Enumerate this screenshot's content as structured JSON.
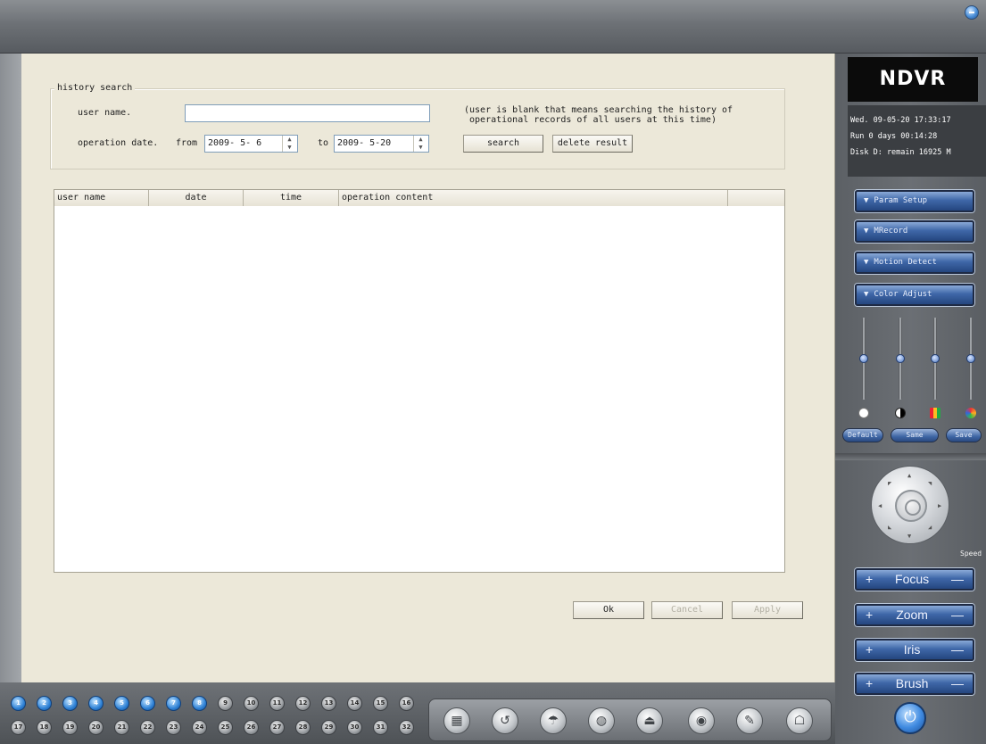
{
  "window": {
    "close_icon": "close-icon"
  },
  "history_search": {
    "legend": "history search",
    "user_name_label": "user name.",
    "user_name_value": "",
    "note_line1": "(user is blank that means searching the history of",
    "note_line2": " operational records of all users at this time)",
    "operation_date_label": "operation date.",
    "from_label": "from",
    "from_value": "2009- 5- 6",
    "to_label": "to",
    "to_value": "2009- 5-20",
    "search_label": "search",
    "delete_label": "delete result"
  },
  "table": {
    "columns": [
      "user name",
      "date",
      "time",
      "operation content",
      ""
    ],
    "rows": []
  },
  "footer_buttons": {
    "ok": "Ok",
    "cancel": "Cancel",
    "apply": "Apply"
  },
  "right_panel": {
    "logo": "NDVR",
    "info_line1": "Wed.  09-05-20 17:33:17",
    "info_line2": "Run 0 days 00:14:28",
    "info_line3": "Disk D: remain 16925 M",
    "menu": [
      {
        "label": "Param Setup"
      },
      {
        "label": "MRecord"
      },
      {
        "label": "Motion Detect"
      },
      {
        "label": "Color Adjust"
      }
    ],
    "color_levels": [
      0.5,
      0.5,
      0.5,
      0.5
    ],
    "color_icons": [
      "brightness-icon",
      "contrast-icon",
      "saturation-icon",
      "hue-icon"
    ],
    "default_btn": "Default",
    "save_btn": "Same",
    "save2_btn": "Save",
    "speed_label": "Speed",
    "ptz": [
      {
        "label": "Focus"
      },
      {
        "label": "Zoom"
      },
      {
        "label": "Iris"
      },
      {
        "label": "Brush"
      }
    ],
    "plus": "+",
    "minus": "—"
  },
  "channels": {
    "row1": [
      "1",
      "2",
      "3",
      "4",
      "5",
      "6",
      "7",
      "8",
      "9",
      "10",
      "11",
      "12",
      "13",
      "14",
      "15",
      "16"
    ],
    "row2": [
      "17",
      "18",
      "19",
      "20",
      "21",
      "22",
      "23",
      "24",
      "25",
      "26",
      "27",
      "28",
      "29",
      "30",
      "31",
      "32"
    ],
    "active_count_row1": 8
  },
  "toolbar_icons": [
    "layout-icon",
    "playback-icon",
    "network-icon",
    "globe-icon",
    "record-icon",
    "camera-icon",
    "edit-icon",
    "lock-icon"
  ]
}
